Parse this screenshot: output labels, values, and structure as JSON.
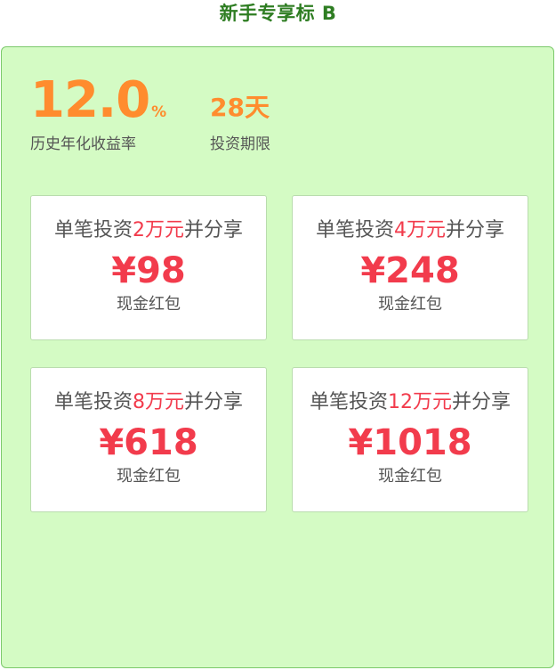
{
  "header": {
    "title": "新手专享标 B"
  },
  "stats": {
    "rate": {
      "value": "12.0",
      "unit": "%",
      "label": "历史年化收益率"
    },
    "term": {
      "value": "28天",
      "label": "投资期限"
    }
  },
  "cards": [
    {
      "prefix": "单笔投资",
      "amount": "2万元",
      "suffix": "并分享",
      "reward": "¥98",
      "reward_type": "现金红包"
    },
    {
      "prefix": "单笔投资",
      "amount": "4万元",
      "suffix": "并分享",
      "reward": "¥248",
      "reward_type": "现金红包"
    },
    {
      "prefix": "单笔投资",
      "amount": "8万元",
      "suffix": "并分享",
      "reward": "¥618",
      "reward_type": "现金红包"
    },
    {
      "prefix": "单笔投资",
      "amount": "12万元",
      "suffix": "并分享",
      "reward": "¥1018",
      "reward_type": "现金红包"
    }
  ],
  "colors": {
    "title": "#2e7d22",
    "panel_bg": "#d4fbc4",
    "panel_border": "#7cc96c",
    "accent_orange": "#ff8c2e",
    "accent_red": "#f23b4c",
    "text_gray": "#555555"
  }
}
